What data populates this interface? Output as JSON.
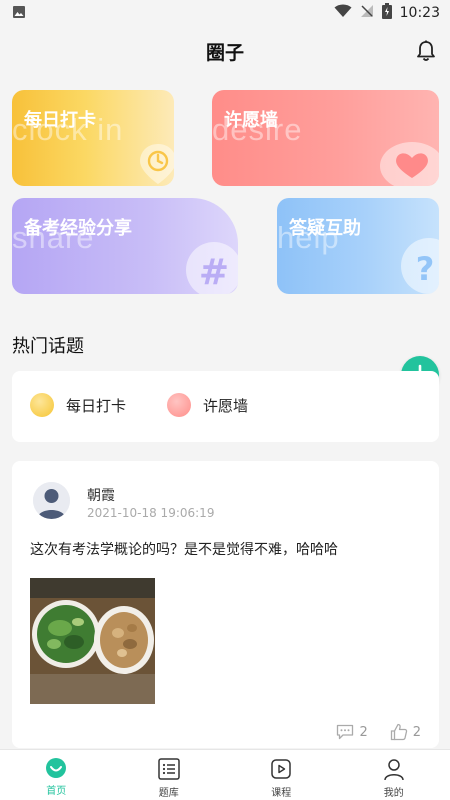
{
  "status_bar": {
    "time": "10:23"
  },
  "header": {
    "title": "圈子"
  },
  "cards": {
    "checkin": {
      "label": "每日打卡",
      "watermark": "clock in"
    },
    "wish": {
      "label": "许愿墙",
      "watermark": "desire"
    },
    "share": {
      "label": "备考经验分享",
      "watermark": "share"
    },
    "help": {
      "label": "答疑互助",
      "watermark": "help"
    }
  },
  "hot_topics": {
    "title": "热门话题",
    "items": [
      {
        "label": "每日打卡"
      },
      {
        "label": "许愿墙"
      }
    ]
  },
  "post": {
    "author": "朝霞",
    "time": "2021-10-18 19:06:19",
    "text": "这次有考法学概论的吗？是不是觉得不难，哈哈哈",
    "comments": "2",
    "likes": "2"
  },
  "tabbar": {
    "items": [
      {
        "label": "首页",
        "active": true
      },
      {
        "label": "题库"
      },
      {
        "label": "课程"
      },
      {
        "label": "我的"
      }
    ]
  },
  "colors": {
    "accent": "#22c39d",
    "checkin": "#f8c13a",
    "wish": "#ff8d89",
    "share": "#b5a6f4",
    "help": "#8ec2f8"
  }
}
